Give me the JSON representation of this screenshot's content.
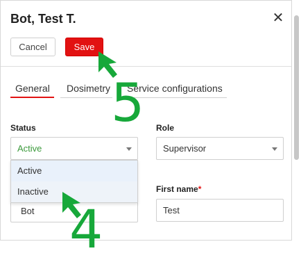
{
  "dialog": {
    "title": "Bot, Test T.",
    "close_icon": "close-icon"
  },
  "toolbar": {
    "cancel_label": "Cancel",
    "save_label": "Save"
  },
  "tabs": [
    {
      "label": "General",
      "active": true
    },
    {
      "label": "Dosimetry",
      "active": false
    },
    {
      "label": "Service configurations",
      "active": false
    }
  ],
  "form": {
    "status_label": "Status",
    "status_value": "Active",
    "status_options": [
      "Active",
      "Inactive"
    ],
    "role_label": "Role",
    "role_value": "Supervisor",
    "first_name_label": "First name",
    "first_name_required_mark": "*",
    "first_name_value": "Test",
    "last_name_value": "Bot"
  },
  "annotations": {
    "step_5": "5",
    "step_4": "4"
  },
  "colors": {
    "accent_red": "#e21212",
    "status_green": "#3c9a3c",
    "annotation_green": "#17a83a"
  }
}
